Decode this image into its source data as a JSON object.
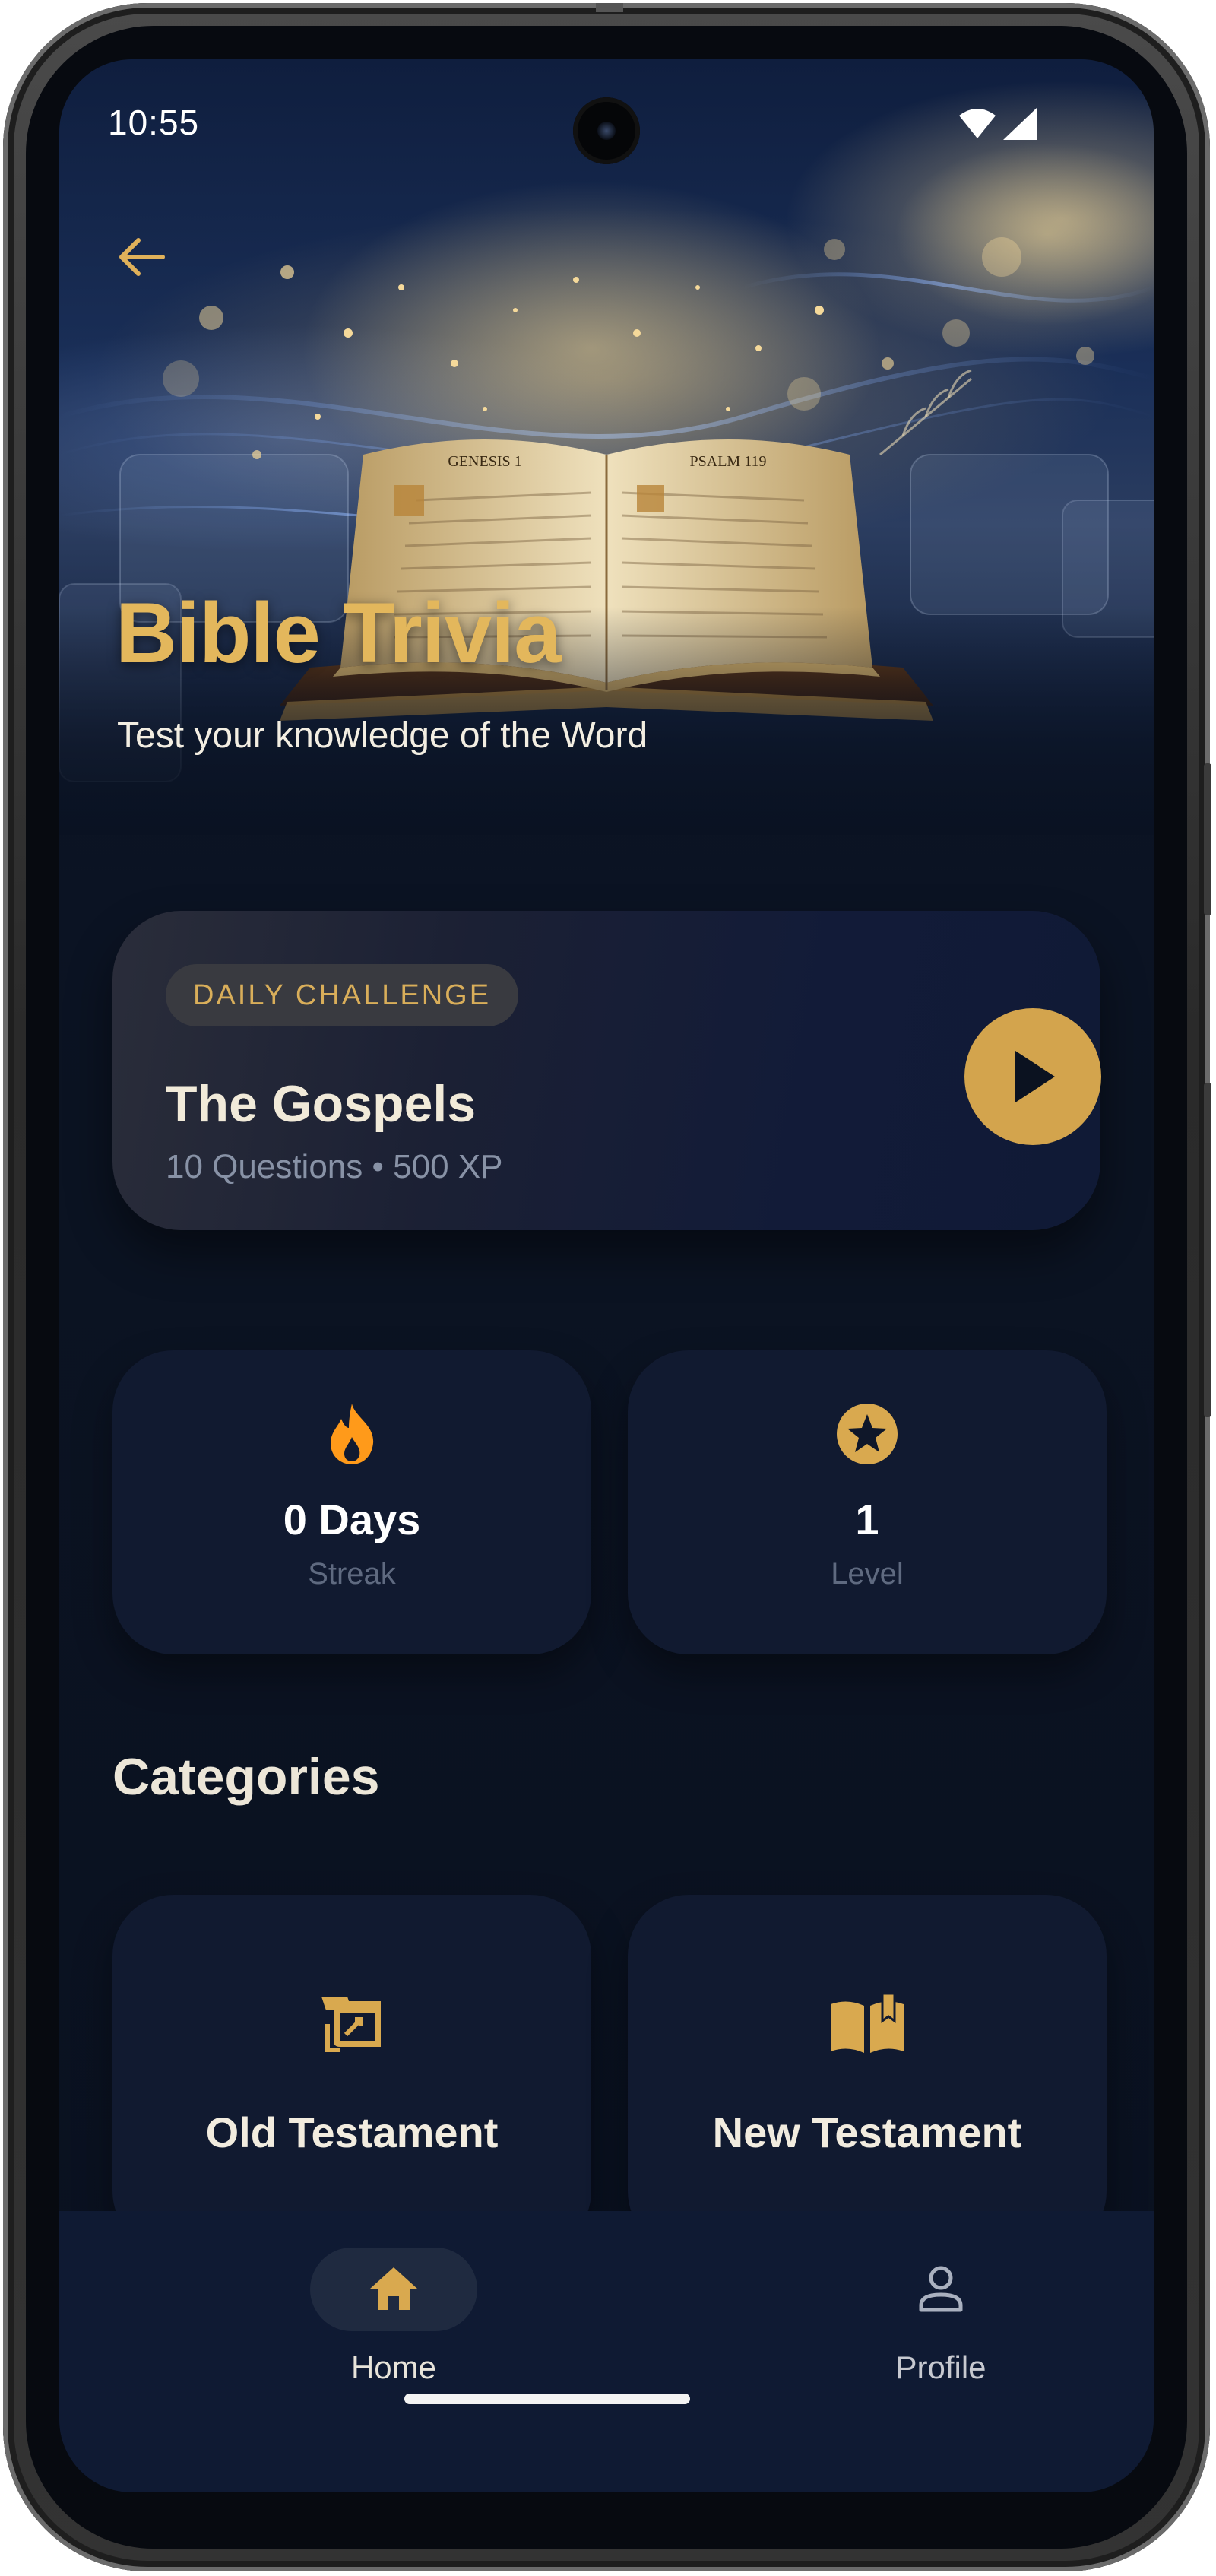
{
  "status_bar": {
    "time": "10:55"
  },
  "hero": {
    "title": "Bible Trivia",
    "subtitle": "Test your knowledge of the Word",
    "book_left_page": "GENESIS 1",
    "book_right_page": "PSALM 119"
  },
  "daily_challenge": {
    "badge": "DAILY CHALLENGE",
    "title": "The Gospels",
    "meta": "10 Questions • 500 XP"
  },
  "stats": [
    {
      "value": "0 Days",
      "label": "Streak",
      "icon": "fire-icon"
    },
    {
      "value": "1",
      "label": "Level",
      "icon": "star-badge-icon"
    }
  ],
  "categories_section": {
    "title": "Categories",
    "items": [
      {
        "label": "Old Testament",
        "icon": "scroll-icon"
      },
      {
        "label": "New Testament",
        "icon": "open-book-icon"
      }
    ]
  },
  "bottom_nav": {
    "items": [
      {
        "label": "Home",
        "icon": "home-icon",
        "active": true
      },
      {
        "label": "Profile",
        "icon": "person-icon",
        "active": false
      }
    ]
  },
  "colors": {
    "accent_gold": "#d3a44d",
    "title_gold": "#e3b75c",
    "background": "#0b1322",
    "card": "#111a30",
    "streak_flame": "#ff9a1a"
  }
}
